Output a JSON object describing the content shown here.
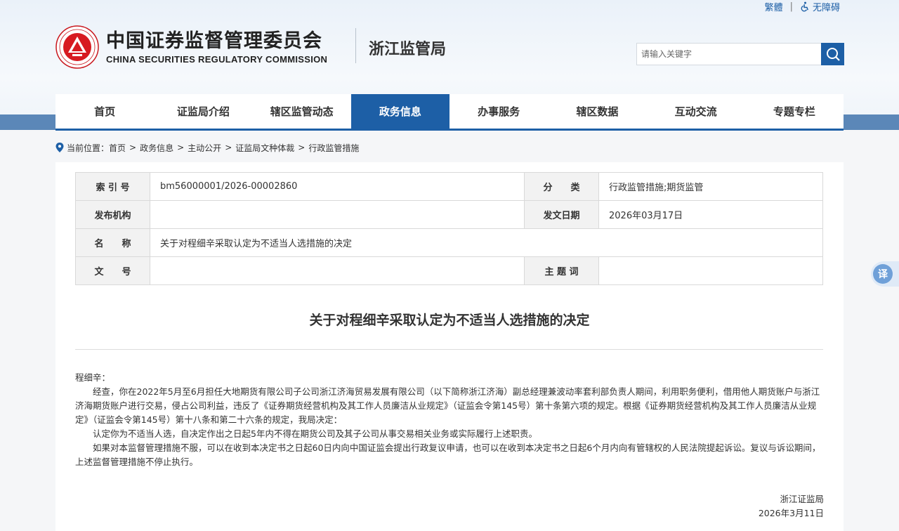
{
  "top_links": {
    "traditional": "繁體",
    "separator": "|",
    "accessibility": "无障碍"
  },
  "header": {
    "logo_cn": "中国证券监督管理委员会",
    "logo_en": "CHINA SECURITIES REGULATORY COMMISSION",
    "bureau": "浙江监管局"
  },
  "search": {
    "placeholder": "请输入关键字",
    "icon": "search-icon"
  },
  "nav": {
    "items": [
      "首页",
      "证监局介绍",
      "辖区监管动态",
      "政务信息",
      "办事服务",
      "辖区数据",
      "互动交流",
      "专题专栏"
    ],
    "active": "政务信息",
    "active_color": "#1d5fa6"
  },
  "breadcrumb": {
    "prefix": "当前位置：",
    "items": [
      "首页",
      "政务信息",
      "主动公开",
      "证监局文种体裁",
      "行政监管措施"
    ],
    "separator": ">"
  },
  "meta": {
    "index_label": "索 引 号",
    "index_value": "bm56000001/2026-00002860",
    "category_label": "分　　类",
    "category_value": "行政监管措施;期货监管",
    "issuer_label": "发布机构",
    "issuer_value": "",
    "date_label": "发文日期",
    "date_value": "2026年03月17日",
    "name_label": "名　　称",
    "name_value": "关于对程细辛采取认定为不适当人选措施的决定",
    "doc_no_label": "文　　号",
    "doc_no_value": "",
    "subject_label": "主 题 词",
    "subject_value": ""
  },
  "document": {
    "title": "关于对程细辛采取认定为不适当人选措施的决定",
    "salutation": "程细辛：",
    "paragraphs": [
      "经查，你在2022年5月至6月担任大地期货有限公司子公司浙江济海贸易发展有限公司（以下简称浙江济海）副总经理兼波动率套利部负责人期间，利用职务便利，借用他人期货账户与浙江济海期货账户进行交易，侵占公司利益，违反了《证券期货经营机构及其工作人员廉洁从业规定》（证监会令第145号）第十条第六项的规定。根据《证券期货经营机构及其工作人员廉洁从业规定》（证监会令第145号）第十八条和第二十六条的规定，我局决定：",
      "认定你为不适当人选，自决定作出之日起5年内不得在期货公司及其子公司从事交易相关业务或实际履行上述职责。",
      "如果对本监督管理措施不服，可以在收到本决定书之日起60日内向中国证监会提出行政复议申请，也可以在收到本决定书之日起6个月内向有管辖权的人民法院提起诉讼。复议与诉讼期间，上述监督管理措施不停止执行。"
    ],
    "signer": "浙江证监局",
    "sign_date": "2026年3月11日"
  },
  "translate_button": "译"
}
